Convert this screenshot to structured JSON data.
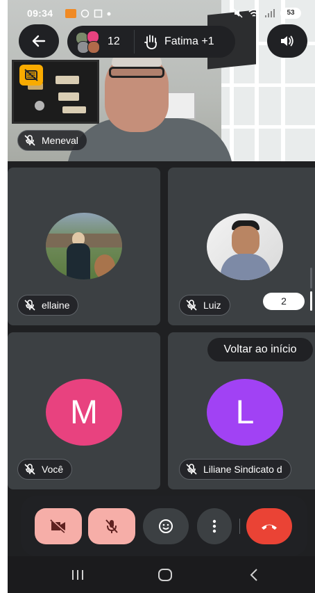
{
  "status_bar": {
    "time": "09:34",
    "battery": "53"
  },
  "call": {
    "participant_count": "12",
    "raised_hands": "Fatima +1",
    "featured_participant": "Meneval"
  },
  "tiles": [
    {
      "name": "ellaine",
      "avatar_type": "photo"
    },
    {
      "name": "Luiz",
      "avatar_type": "photo"
    },
    {
      "name": "Você",
      "avatar_type": "letter",
      "letter": "M",
      "color": "#e8427f"
    },
    {
      "name": "Liliane Sindicato d",
      "avatar_type": "letter",
      "letter": "L",
      "color": "#a142f4"
    }
  ],
  "page_indicator": "2",
  "back_to_start": "Voltar ao início",
  "controls": {
    "camera": "camera-off-icon",
    "mic": "mic-off-icon",
    "emoji": "emoji-icon",
    "more": "more-vert-icon",
    "end_call": "call-end-icon"
  },
  "colors": {
    "background": "#1f2022",
    "tile": "#3c4043",
    "toggle_off": "#f6aea8",
    "end_call": "#ea4335",
    "camera_off_badge": "#f9ab00"
  }
}
